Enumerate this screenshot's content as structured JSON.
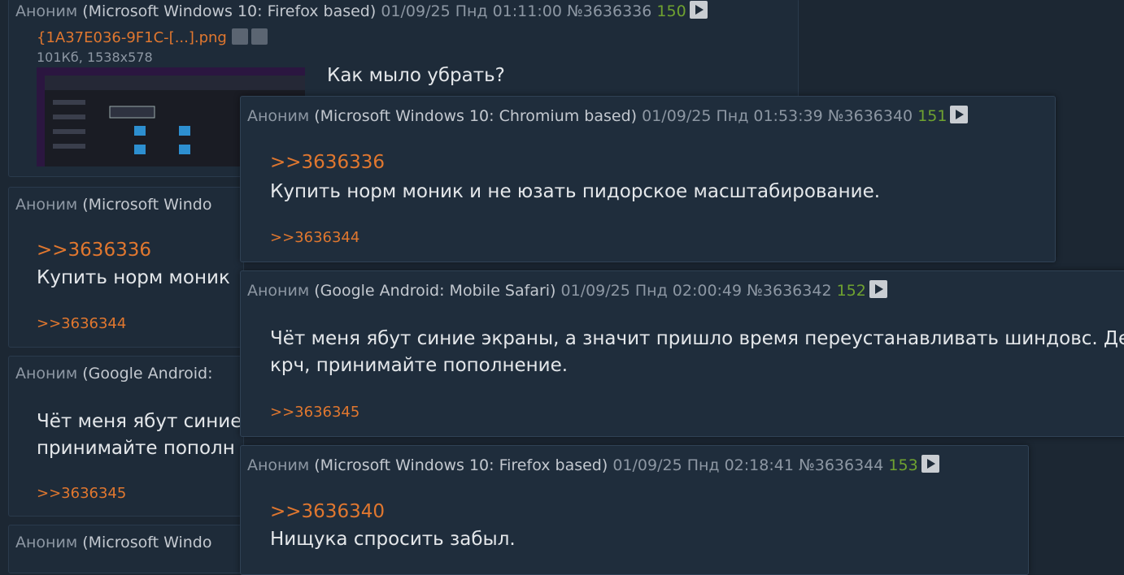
{
  "posts": [
    {
      "name": "Аноним",
      "os": "(Microsoft Windows 10: Firefox based)",
      "date": "01/09/25 Пнд 01:11:00",
      "num": "№3636336",
      "count": "150",
      "file": {
        "name": "{1A37E036-9F1C-[...].png",
        "meta": "101Кб, 1538x578"
      },
      "text": "Как мыло убрать?"
    },
    {
      "name": "Аноним",
      "os": "(Microsoft Windo",
      "reply_to": ">>3636336",
      "text": "Купить норм моник",
      "reply": ">>3636344"
    },
    {
      "name": "Аноним",
      "os": "(Google Android:",
      "text1": "Чёт меня ябут синие",
      "text2": "принимайте пополн",
      "reply": ">>3636345"
    },
    {
      "name": "Аноним",
      "os": "(Microsoft Windo"
    }
  ],
  "popups": [
    {
      "name": "Аноним",
      "os": "(Microsoft Windows 10: Chromium based)",
      "date": "01/09/25 Пнд 01:53:39",
      "num": "№3636340",
      "count": "151",
      "reply_to": ">>3636336",
      "text": "Купить норм моник и не юзать пидорское масштабирование.",
      "reply": ">>3636344"
    },
    {
      "name": "Аноним",
      "os": "(Google Android: Mobile Safari)",
      "date": "01/09/25 Пнд 02:00:49",
      "num": "№3636342",
      "count": "152",
      "text1": "Чёт меня ябут синие экраны, а значит пришло время переустанавливать шиндовс. Деся",
      "text2": "крч, принимайте пополнение.",
      "reply": ">>3636345"
    },
    {
      "name": "Аноним",
      "os": "(Microsoft Windows 10: Firefox based)",
      "date": "01/09/25 Пнд 02:18:41",
      "num": "№3636344",
      "count": "153",
      "reply_to": ">>3636340",
      "text": "Нищука спросить забыл."
    }
  ],
  "colors": {
    "background": "#1c2733",
    "post": "#1e2b39",
    "link": "#e0772f",
    "count": "#6fa230",
    "meta": "#8d97a3"
  }
}
